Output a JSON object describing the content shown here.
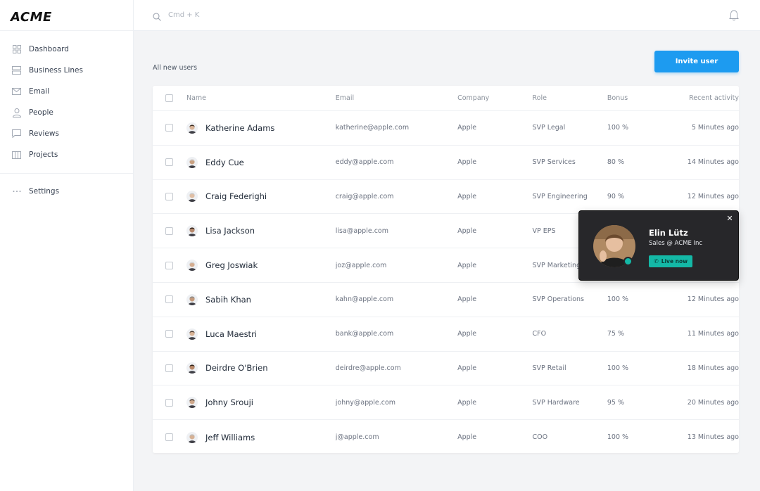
{
  "app": {
    "logo": "ACME"
  },
  "sidebar": {
    "items": [
      {
        "label": "Dashboard",
        "icon": "dashboard-icon"
      },
      {
        "label": "Business Lines",
        "icon": "business-lines-icon"
      },
      {
        "label": "Email",
        "icon": "email-icon"
      },
      {
        "label": "People",
        "icon": "people-icon"
      },
      {
        "label": "Reviews",
        "icon": "reviews-icon"
      },
      {
        "label": "Projects",
        "icon": "projects-icon"
      }
    ],
    "settings": {
      "label": "Settings",
      "icon": "more-icon"
    }
  },
  "topbar": {
    "search_placeholder": "Cmd + K",
    "notification_icon": "bell-icon"
  },
  "main": {
    "title": "All new users",
    "invite_label": "Invite user",
    "accent": "#1d9bf0"
  },
  "table": {
    "headers": {
      "name": "Name",
      "email": "Email",
      "company": "Company",
      "role": "Role",
      "bonus": "Bonus",
      "activity": "Recent activity"
    },
    "rows": [
      {
        "name": "Katherine Adams",
        "email": "katherine@apple.com",
        "company": "Apple",
        "role": "SVP Legal",
        "bonus": "100 %",
        "activity": "5 Minutes ago"
      },
      {
        "name": "Eddy Cue",
        "email": "eddy@apple.com",
        "company": "Apple",
        "role": "SVP Services",
        "bonus": "80 %",
        "activity": "14 Minutes ago"
      },
      {
        "name": "Craig Federighi",
        "email": "craig@apple.com",
        "company": "Apple",
        "role": "SVP Engineering",
        "bonus": "90 %",
        "activity": "12 Minutes ago"
      },
      {
        "name": "Lisa Jackson",
        "email": "lisa@apple.com",
        "company": "Apple",
        "role": "VP EPS",
        "bonus": "",
        "activity": ""
      },
      {
        "name": "Greg Joswiak",
        "email": "joz@apple.com",
        "company": "Apple",
        "role": "SVP Marketing",
        "bonus": "",
        "activity": ""
      },
      {
        "name": "Sabih Khan",
        "email": "kahn@apple.com",
        "company": "Apple",
        "role": "SVP Operations",
        "bonus": "100 %",
        "activity": "12 Minutes ago"
      },
      {
        "name": "Luca Maestri",
        "email": "bank@apple.com",
        "company": "Apple",
        "role": "CFO",
        "bonus": "75 %",
        "activity": "11 Minutes ago"
      },
      {
        "name": "Deirdre O'Brien",
        "email": "deirdre@apple.com",
        "company": "Apple",
        "role": "SVP Retail",
        "bonus": "100 %",
        "activity": "18 Minutes ago"
      },
      {
        "name": "Johny Srouji",
        "email": "johny@apple.com",
        "company": "Apple",
        "role": "SVP Hardware",
        "bonus": "95 %",
        "activity": "20 Minutes ago"
      },
      {
        "name": "Jeff Williams",
        "email": "j@apple.com",
        "company": "Apple",
        "role": "COO",
        "bonus": "100 %",
        "activity": "13 Minutes ago"
      }
    ]
  },
  "popup": {
    "name": "Elin Lütz",
    "subtitle": "Sales @ ACME Inc",
    "live_label": "Live now",
    "status_color": "#14b8a6"
  }
}
